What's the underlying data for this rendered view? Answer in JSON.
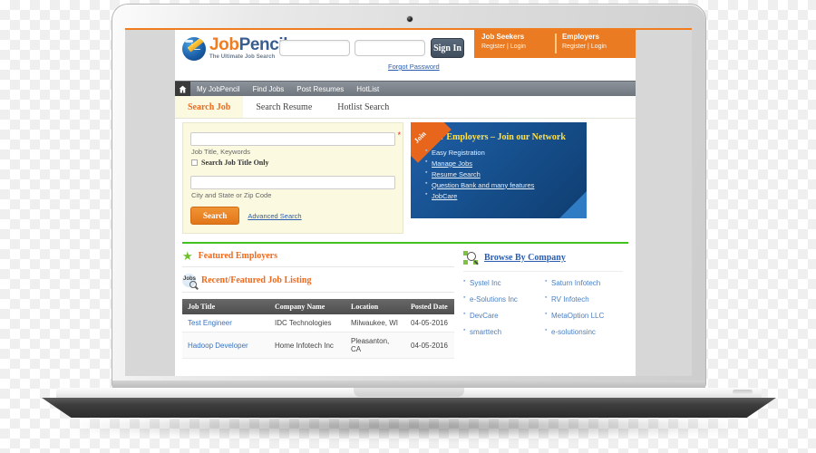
{
  "device": {
    "type": "laptop",
    "webcam": "webcam-dot"
  },
  "site": {
    "header": {
      "logo": {
        "word_primary": "Job",
        "word_secondary": "Pencil",
        "tagline": "The Ultimate Job Search"
      },
      "keyword_input": {
        "value": "",
        "placeholder": ""
      },
      "location_input": {
        "value": "",
        "placeholder": ""
      },
      "signin_label": "Sign In",
      "forgot_password_label": "Forgot Password",
      "account_bar": [
        {
          "title": "Job Seekers",
          "register": "Register",
          "separator": "|",
          "login": "Login"
        },
        {
          "title": "Employers",
          "register": "Register",
          "separator": "|",
          "login": "Login"
        }
      ]
    },
    "navbar": {
      "home_icon": "home-icon",
      "items": [
        {
          "label": "My JobPencil"
        },
        {
          "label": "Find Jobs"
        },
        {
          "label": "Post Resumes"
        },
        {
          "label": "HotList"
        }
      ]
    },
    "tabs": [
      {
        "label": "Search Job",
        "active": true
      },
      {
        "label": "Search Resume",
        "active": false
      },
      {
        "label": "Hotlist Search",
        "active": false
      }
    ],
    "search_panel": {
      "keyword_input": {
        "value": "",
        "placeholder": ""
      },
      "keyword_hint": "Job Title, Keywords",
      "required_marker": "*",
      "checkbox_label": "Search Job Title Only",
      "checkbox_checked": false,
      "location_input": {
        "value": "",
        "placeholder": ""
      },
      "location_hint": "City and State or Zip Code",
      "search_button": "Search",
      "advanced_search_link": "Advanced Search"
    },
    "promo": {
      "ribbon": "Join",
      "title": "Dear Employers – Join our Network",
      "items": [
        {
          "label": "Easy Registration",
          "link": false
        },
        {
          "label": "Manage Jobs",
          "link": true
        },
        {
          "label": "Resume Search",
          "link": true
        },
        {
          "label": "Question Bank and many features",
          "link": true
        },
        {
          "label": "JobCare",
          "link": true
        }
      ]
    },
    "featured_employers": {
      "icon": "star-icon",
      "title": "Featured Employers"
    },
    "job_listing": {
      "icon": "jobs-search-icon",
      "title": "Recent/Featured Job Listing",
      "columns": [
        "Job Title",
        "Company Name",
        "Location",
        "Posted Date"
      ],
      "rows": [
        {
          "title": "Test Engineer",
          "company": "IDC Technologies",
          "location": "Milwaukee, WI",
          "posted": "04-05-2016"
        },
        {
          "title": "Hadoop Developer",
          "company": "Home Infotech Inc",
          "location": "Pleasanton, CA",
          "posted": "04-05-2016"
        }
      ]
    },
    "browse_by_company": {
      "icon": "browse-search-icon",
      "title": "Browse By Company",
      "companies": [
        "Systel Inc",
        "Saturn Infotech",
        "e-Solutions Inc",
        "RV Infotech",
        "DevCare",
        "MetaOption LLC",
        "smarttech",
        "e-solutionsinc"
      ]
    }
  },
  "colors": {
    "brand_orange": "#ea7b22",
    "brand_blue": "#3a5d8f",
    "accent_green": "#43c21f",
    "promo_blue": "#17518f",
    "promo_yellow": "#ffe14a",
    "link_blue": "#2a5db0",
    "panel_cream": "#fbfae0"
  }
}
